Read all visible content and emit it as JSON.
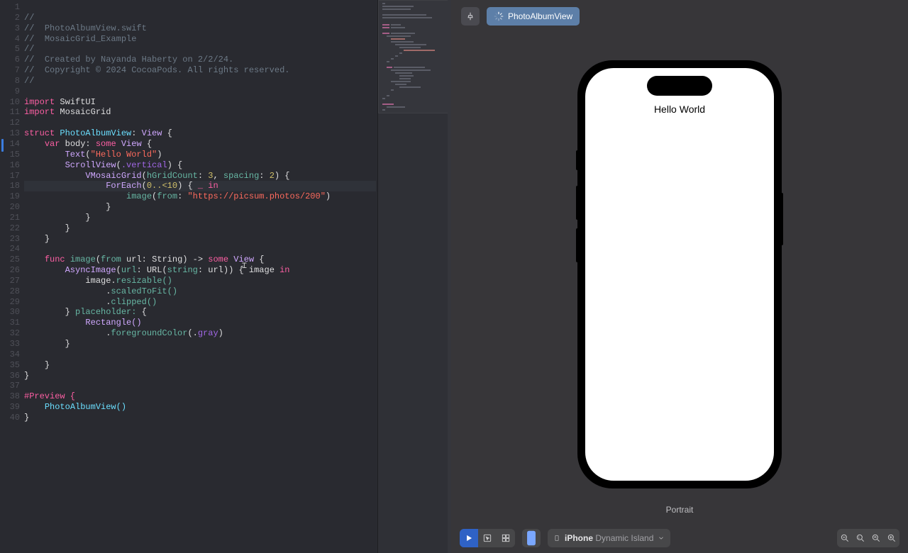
{
  "file": {
    "name": "PhotoAlbumView.swift",
    "project": "MosaicGrid_Example",
    "createdBy": "Created by Nayanda Haberty on 2/2/24.",
    "copyright": "Copyright © 2024 CocoaPods. All rights reserved."
  },
  "code": {
    "lineNumbers": [
      "1",
      "2",
      "3",
      "4",
      "5",
      "6",
      "7",
      "8",
      "9",
      "10",
      "11",
      "12",
      "13",
      "14",
      "15",
      "16",
      "17",
      "18",
      "19",
      "20",
      "21",
      "22",
      "23",
      "24",
      "25",
      "26",
      "27",
      "28",
      "29",
      "30",
      "31",
      "32",
      "33",
      "34",
      "35",
      "36",
      "37",
      "38",
      "39",
      "40"
    ],
    "imports": [
      "SwiftUI",
      "MosaicGrid"
    ],
    "structName": "PhotoAlbumView",
    "protocol": "View",
    "bodyKw": "var body: some View {",
    "textLiteral": "\"Hello World\"",
    "scrollAxis": ".vertical",
    "vmosaic": {
      "hGridCount": "3",
      "spacing": "2"
    },
    "foreachRange": "0..<10",
    "imageUrl": "\"https://picsum.photos/200\"",
    "fn": {
      "name": "image",
      "param": "from url: String",
      "ret": "some View"
    },
    "asyncImageParam": "url: URL(string: url))",
    "closureParam": "image in",
    "mods": [
      "resizable()",
      "scaledToFit()",
      "clipped()"
    ],
    "placeholder": "placeholder:",
    "rect": "Rectangle()",
    "fg": ".foregroundColor(.gray)",
    "previewMacro": "#Preview {",
    "previewCall": "PhotoAlbumView()"
  },
  "preview": {
    "chipLabel": "PhotoAlbumView",
    "helloText": "Hello World",
    "orientation": "Portrait",
    "deviceLabelStrong": "iPhone",
    "deviceLabelRest": "Dynamic Island"
  }
}
